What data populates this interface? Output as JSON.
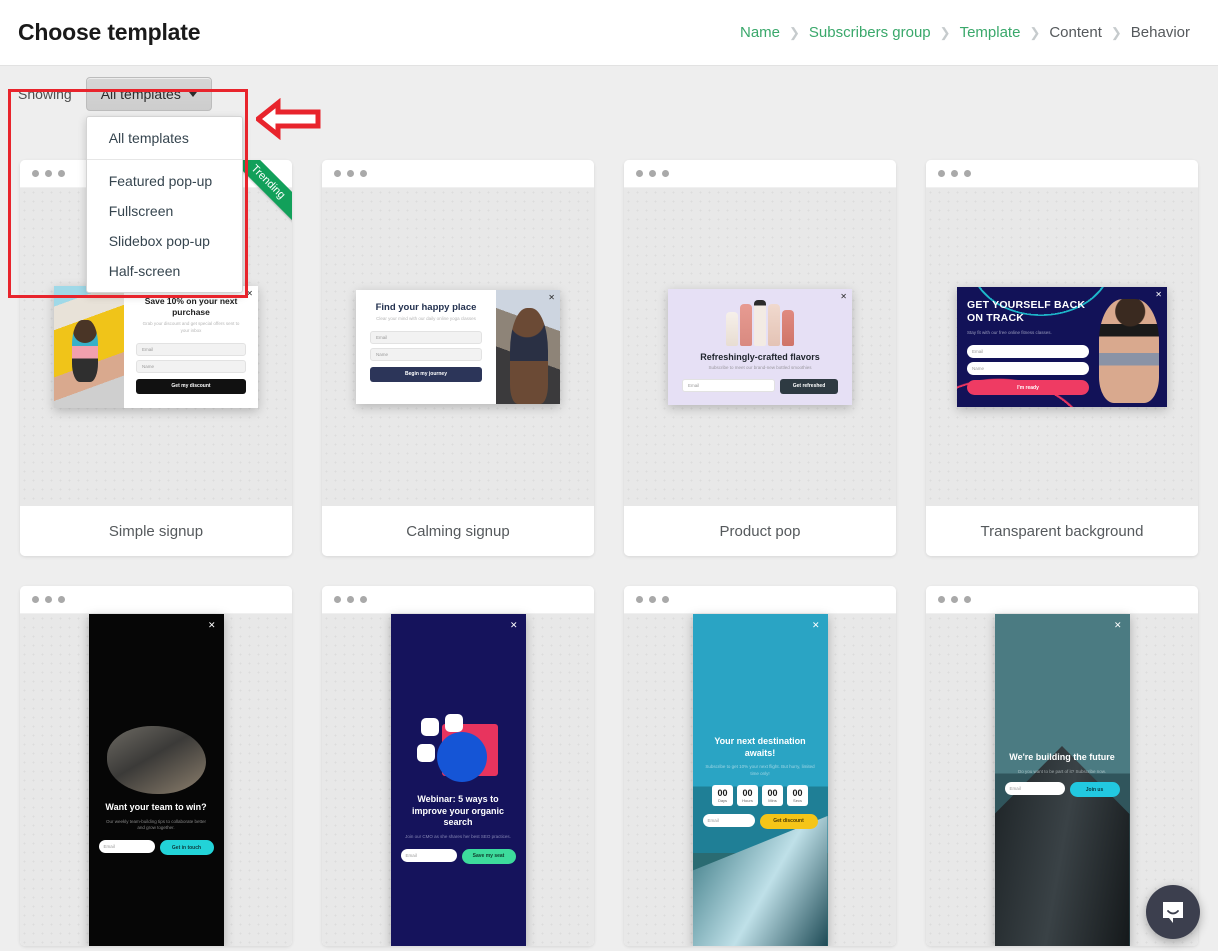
{
  "header": {
    "title": "Choose template",
    "breadcrumb": [
      {
        "label": "Name",
        "state": "done"
      },
      {
        "label": "Subscribers group",
        "state": "done"
      },
      {
        "label": "Template",
        "state": "done"
      },
      {
        "label": "Content",
        "state": "todo"
      },
      {
        "label": "Behavior",
        "state": "todo"
      }
    ],
    "separator": "❯"
  },
  "filter": {
    "showing_label": "Showing",
    "selected": "All templates",
    "menu_items": [
      "All templates",
      "Featured pop-up",
      "Fullscreen",
      "Slidebox pop-up",
      "Half-screen"
    ]
  },
  "annotations": {
    "highlight_color": "#e8242c",
    "arrow_icon": "left-arrow-icon"
  },
  "ribbon": {
    "label": "Trending",
    "color": "#12a05a"
  },
  "templates": [
    {
      "name": "Simple signup",
      "ribbon": "Trending",
      "popup": {
        "headline": "Save 10% on your next purchase",
        "subtext": "Grab your discount and get special offers sent to your inbox",
        "fields": [
          "Email",
          "Name"
        ],
        "cta": "Get my discount",
        "cta_color": "#111111",
        "close_icon": "close-icon"
      }
    },
    {
      "name": "Calming signup",
      "ribbon": "",
      "popup": {
        "headline": "Find your happy place",
        "subtext": "Clear your mind with our daily online yoga classes",
        "fields": [
          "Email",
          "Name"
        ],
        "cta": "Begin my journey",
        "cta_color": "#2c3559",
        "close_icon": "close-icon"
      }
    },
    {
      "name": "Product pop",
      "ribbon": "",
      "popup": {
        "headline": "Refreshingly-crafted flavors",
        "subtext": "Subscribe to meet our brand-new bottled smoothies",
        "fields": [
          "Email"
        ],
        "cta": "Get refreshed",
        "cta_color": "#2e3a42",
        "close_icon": "close-icon"
      }
    },
    {
      "name": "Transparent background",
      "ribbon": "",
      "popup": {
        "headline": "GET YOURSELF BACK ON TRACK",
        "subtext": "Stay fit with our free online fitness classes.",
        "fields": [
          "Email",
          "Name"
        ],
        "cta": "I'm ready",
        "cta_color": "#ef3b63",
        "close_icon": "close-icon"
      }
    },
    {
      "name": "",
      "ribbon": "",
      "popup": {
        "headline": "Want your team to win?",
        "subtext": "Our weekly team-building tips to collaborate better and grow together.",
        "fields": [
          "Email"
        ],
        "cta": "Get in touch",
        "cta_color": "#22d3d8",
        "close_icon": "close-icon"
      }
    },
    {
      "name": "",
      "ribbon": "",
      "popup": {
        "headline": "Webinar: 5 ways to improve your organic search",
        "subtext": "Join our CMO as she shares her best SEO practices.",
        "fields": [
          "Email"
        ],
        "cta": "Save my seat",
        "cta_color": "#3ddb9c",
        "close_icon": "close-icon"
      }
    },
    {
      "name": "",
      "ribbon": "",
      "popup": {
        "headline": "Your next destination awaits!",
        "subtext": "Subscribe to get 10% your next flight. But hurry, limited time only!",
        "fields": [
          "Email"
        ],
        "cta": "Get discount",
        "cta_color": "#f5c518",
        "countdown": [
          {
            "value": "00",
            "label": "Days"
          },
          {
            "value": "00",
            "label": "Hours"
          },
          {
            "value": "00",
            "label": "Mins"
          },
          {
            "value": "00",
            "label": "Secs"
          }
        ],
        "close_icon": "close-icon"
      }
    },
    {
      "name": "",
      "ribbon": "",
      "popup": {
        "headline": "We're building the future",
        "subtext": "Do you want to be part of it? Subscribe now.",
        "fields": [
          "Email"
        ],
        "cta": "Join us",
        "cta_color": "#22c8e0",
        "close_icon": "close-icon"
      }
    }
  ],
  "chat": {
    "icon": "chat-bubble-icon"
  }
}
